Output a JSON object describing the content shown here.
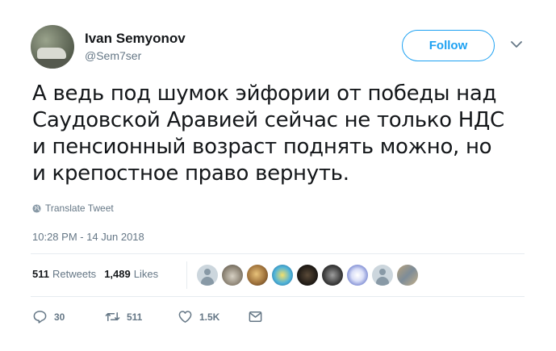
{
  "user": {
    "name": "Ivan Semyonov",
    "handle": "@Sem7ser",
    "follow_label": "Follow"
  },
  "tweet": {
    "lines": [
      "А ведь под шумок эйфории от победы над",
      "Саудовской Аравией сейчас не только НДС",
      "и пенсионный возраст поднять можно, но",
      "и крепостное право вернуть."
    ],
    "translate_label": "Translate Tweet",
    "timestamp": "10:28 PM - 14 Jun 2018"
  },
  "stats": {
    "retweets_count": "511",
    "retweets_label": "Retweets",
    "likes_count": "1,489",
    "likes_label": "Likes"
  },
  "actions": {
    "replies": "30",
    "retweets": "511",
    "likes": "1.5K"
  },
  "colors": {
    "accent": "#1da1f2",
    "secondary_text": "#657786",
    "primary_text": "#14171a",
    "divider": "#e6ecf0"
  },
  "icons": [
    "chevron-down-icon",
    "globe-icon",
    "reply-icon",
    "retweet-icon",
    "heart-icon",
    "message-icon"
  ]
}
